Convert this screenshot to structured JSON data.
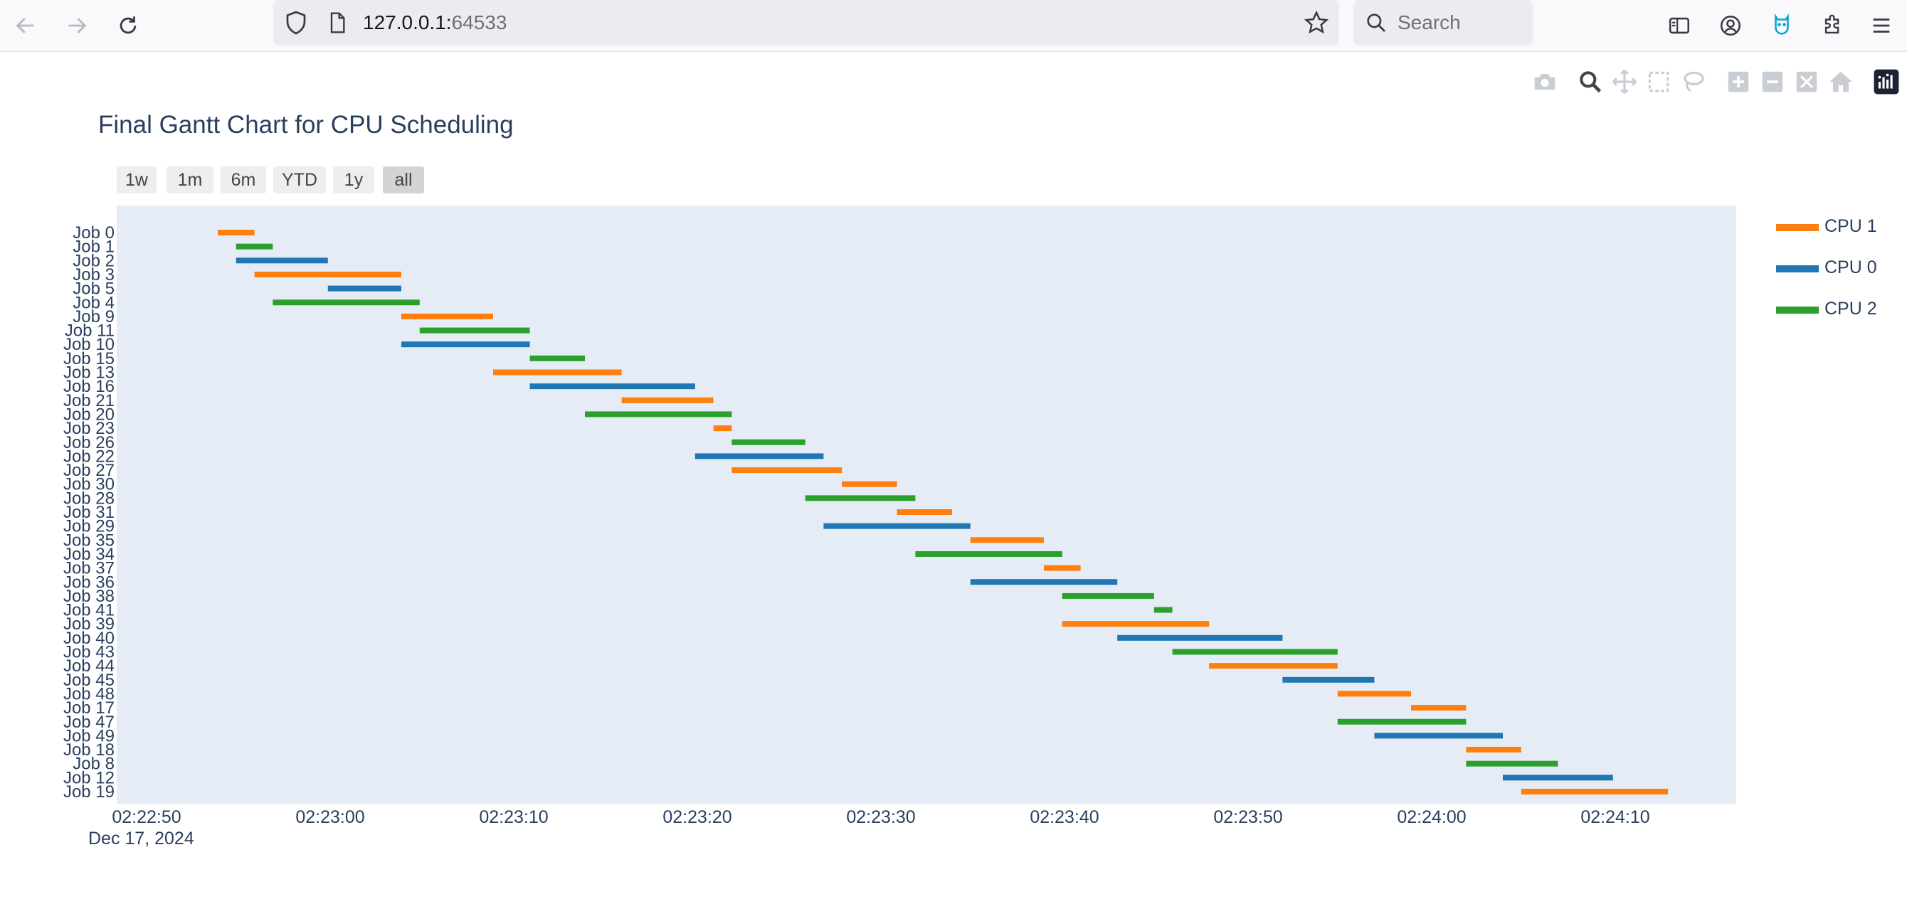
{
  "browser": {
    "url_host": "127.0.0.1:",
    "url_port": "64533",
    "search_placeholder": "Search"
  },
  "colors": {
    "cpu1": "#ff7f0e",
    "cpu0": "#1f77b4",
    "cpu2": "#2ca02c",
    "plot_bg": "#e5ecf6",
    "text": "#2a3f5f"
  },
  "range_buttons": [
    "1w",
    "1m",
    "6m",
    "YTD",
    "1y",
    "all"
  ],
  "range_selected": "all",
  "legend": [
    {
      "name": "CPU 1",
      "color": "#ff7f0e"
    },
    {
      "name": "CPU 0",
      "color": "#1f77b4"
    },
    {
      "name": "CPU 2",
      "color": "#2ca02c"
    }
  ],
  "chart_data": {
    "type": "gantt",
    "title": "Final Gantt Chart for CPU Scheduling",
    "x_axis": {
      "type": "date",
      "date_label": "Dec 17, 2024",
      "range": [
        "02:22:50",
        "02:24:17"
      ],
      "tick_labels": [
        "02:22:50",
        "02:23:00",
        "02:23:10",
        "02:23:20",
        "02:23:30",
        "02:23:40",
        "02:23:50",
        "02:24:00",
        "02:24:10"
      ]
    },
    "grid": false,
    "legend_position": "right",
    "tasks": [
      {
        "job": "Job 0",
        "cpu": "CPU 1",
        "start": "02:22:55",
        "end": "02:22:57"
      },
      {
        "job": "Job 1",
        "cpu": "CPU 2",
        "start": "02:22:56",
        "end": "02:22:58"
      },
      {
        "job": "Job 2",
        "cpu": "CPU 0",
        "start": "02:22:56",
        "end": "02:23:01"
      },
      {
        "job": "Job 3",
        "cpu": "CPU 1",
        "start": "02:22:57",
        "end": "02:23:05"
      },
      {
        "job": "Job 5",
        "cpu": "CPU 0",
        "start": "02:23:01",
        "end": "02:23:05"
      },
      {
        "job": "Job 4",
        "cpu": "CPU 2",
        "start": "02:22:58",
        "end": "02:23:06"
      },
      {
        "job": "Job 9",
        "cpu": "CPU 1",
        "start": "02:23:05",
        "end": "02:23:10"
      },
      {
        "job": "Job 11",
        "cpu": "CPU 2",
        "start": "02:23:06",
        "end": "02:23:12"
      },
      {
        "job": "Job 10",
        "cpu": "CPU 0",
        "start": "02:23:05",
        "end": "02:23:12"
      },
      {
        "job": "Job 15",
        "cpu": "CPU 2",
        "start": "02:23:12",
        "end": "02:23:15"
      },
      {
        "job": "Job 13",
        "cpu": "CPU 1",
        "start": "02:23:10",
        "end": "02:23:17"
      },
      {
        "job": "Job 16",
        "cpu": "CPU 0",
        "start": "02:23:12",
        "end": "02:23:21"
      },
      {
        "job": "Job 21",
        "cpu": "CPU 1",
        "start": "02:23:17",
        "end": "02:23:22"
      },
      {
        "job": "Job 20",
        "cpu": "CPU 2",
        "start": "02:23:15",
        "end": "02:23:23"
      },
      {
        "job": "Job 23",
        "cpu": "CPU 1",
        "start": "02:23:22",
        "end": "02:23:23"
      },
      {
        "job": "Job 26",
        "cpu": "CPU 2",
        "start": "02:23:23",
        "end": "02:23:27"
      },
      {
        "job": "Job 22",
        "cpu": "CPU 0",
        "start": "02:23:21",
        "end": "02:23:28"
      },
      {
        "job": "Job 27",
        "cpu": "CPU 1",
        "start": "02:23:23",
        "end": "02:23:29"
      },
      {
        "job": "Job 30",
        "cpu": "CPU 1",
        "start": "02:23:29",
        "end": "02:23:32"
      },
      {
        "job": "Job 28",
        "cpu": "CPU 2",
        "start": "02:23:27",
        "end": "02:23:33"
      },
      {
        "job": "Job 31",
        "cpu": "CPU 1",
        "start": "02:23:32",
        "end": "02:23:35"
      },
      {
        "job": "Job 29",
        "cpu": "CPU 0",
        "start": "02:23:28",
        "end": "02:23:36"
      },
      {
        "job": "Job 35",
        "cpu": "CPU 1",
        "start": "02:23:36",
        "end": "02:23:40"
      },
      {
        "job": "Job 34",
        "cpu": "CPU 2",
        "start": "02:23:33",
        "end": "02:23:41"
      },
      {
        "job": "Job 37",
        "cpu": "CPU 1",
        "start": "02:23:40",
        "end": "02:23:42"
      },
      {
        "job": "Job 36",
        "cpu": "CPU 0",
        "start": "02:23:36",
        "end": "02:23:44"
      },
      {
        "job": "Job 38",
        "cpu": "CPU 2",
        "start": "02:23:41",
        "end": "02:23:46"
      },
      {
        "job": "Job 41",
        "cpu": "CPU 2",
        "start": "02:23:46",
        "end": "02:23:47"
      },
      {
        "job": "Job 39",
        "cpu": "CPU 1",
        "start": "02:23:41",
        "end": "02:23:49"
      },
      {
        "job": "Job 40",
        "cpu": "CPU 0",
        "start": "02:23:44",
        "end": "02:23:53"
      },
      {
        "job": "Job 43",
        "cpu": "CPU 2",
        "start": "02:23:47",
        "end": "02:23:56"
      },
      {
        "job": "Job 44",
        "cpu": "CPU 1",
        "start": "02:23:49",
        "end": "02:23:56"
      },
      {
        "job": "Job 45",
        "cpu": "CPU 0",
        "start": "02:23:53",
        "end": "02:23:58"
      },
      {
        "job": "Job 48",
        "cpu": "CPU 1",
        "start": "02:23:56",
        "end": "02:24:00"
      },
      {
        "job": "Job 17",
        "cpu": "CPU 1",
        "start": "02:24:00",
        "end": "02:24:03"
      },
      {
        "job": "Job 47",
        "cpu": "CPU 2",
        "start": "02:23:56",
        "end": "02:24:03"
      },
      {
        "job": "Job 49",
        "cpu": "CPU 0",
        "start": "02:23:58",
        "end": "02:24:05"
      },
      {
        "job": "Job 18",
        "cpu": "CPU 1",
        "start": "02:24:03",
        "end": "02:24:06"
      },
      {
        "job": "Job 8",
        "cpu": "CPU 2",
        "start": "02:24:03",
        "end": "02:24:08"
      },
      {
        "job": "Job 12",
        "cpu": "CPU 0",
        "start": "02:24:05",
        "end": "02:24:11"
      },
      {
        "job": "Job 19",
        "cpu": "CPU 1",
        "start": "02:24:06",
        "end": "02:24:14"
      }
    ]
  }
}
